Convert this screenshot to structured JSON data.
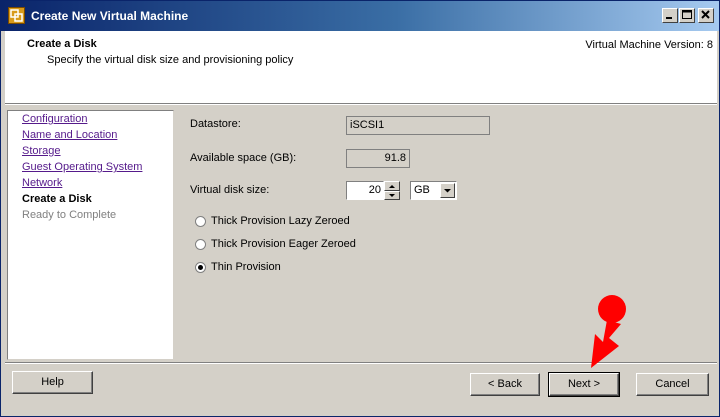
{
  "window": {
    "title": "Create New Virtual Machine"
  },
  "header": {
    "title": "Create a Disk",
    "subtitle": "Specify the virtual disk size and provisioning policy",
    "version": "Virtual Machine Version: 8"
  },
  "nav": {
    "items": [
      {
        "label": "Configuration",
        "state": "link"
      },
      {
        "label": "Name and Location",
        "state": "link"
      },
      {
        "label": "Storage",
        "state": "link"
      },
      {
        "label": "Guest Operating System",
        "state": "link"
      },
      {
        "label": "Network",
        "state": "link"
      },
      {
        "label": "Create a Disk",
        "state": "current"
      },
      {
        "label": "Ready to Complete",
        "state": "pending"
      }
    ]
  },
  "form": {
    "datastore_label": "Datastore:",
    "datastore_value": "iSCSI1",
    "available_label": "Available space (GB):",
    "available_value": "91.8",
    "disk_size_label": "Virtual disk size:",
    "disk_size_value": "20",
    "disk_unit": "GB",
    "provisioning": [
      {
        "label": "Thick Provision Lazy Zeroed",
        "checked": false
      },
      {
        "label": "Thick Provision Eager Zeroed",
        "checked": false
      },
      {
        "label": "Thin Provision",
        "checked": true
      }
    ]
  },
  "buttons": {
    "help": "Help",
    "back": "< Back",
    "next": "Next >",
    "cancel": "Cancel"
  },
  "colors": {
    "titlebar": "#0a246a",
    "arrow": "#ff0000",
    "link": "#551a8b"
  },
  "icons": {
    "app": "vsphere-icon",
    "annotation": "red-pointer-arrow"
  }
}
